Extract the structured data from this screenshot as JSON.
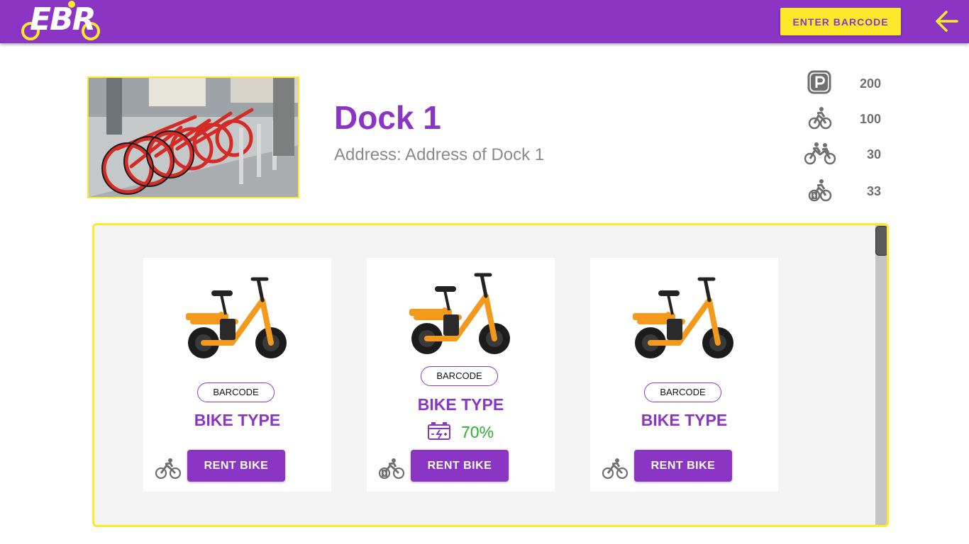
{
  "app": {
    "logo_text": "EBR",
    "enter_barcode_label": "ENTER BARCODE",
    "colors": {
      "primary": "#8b35c4",
      "accent": "#fde92a",
      "battery": "#2ead34"
    }
  },
  "dock": {
    "name": "Dock 1",
    "address": "Address: Address of Dock 1",
    "photo": "red-bikes-dock-photo"
  },
  "stats": [
    {
      "icon": "parking-icon",
      "value": "200"
    },
    {
      "icon": "bike-icon",
      "value": "100"
    },
    {
      "icon": "twin-bike-icon",
      "value": "30"
    },
    {
      "icon": "electric-bike-icon",
      "value": "33"
    }
  ],
  "bikes": [
    {
      "barcode": "BARCODE",
      "type": "BIKE TYPE",
      "battery": "",
      "icon": "bike-icon",
      "rent_label": "RENT BIKE"
    },
    {
      "barcode": "BARCODE",
      "type": "BIKE TYPE",
      "battery": "70%",
      "battery_icon": "battery-icon",
      "icon": "electric-bike-icon",
      "rent_label": "RENT BIKE"
    },
    {
      "barcode": "BARCODE",
      "type": "BIKE TYPE",
      "battery": "",
      "icon": "bike-icon",
      "rent_label": "RENT BIKE"
    }
  ]
}
